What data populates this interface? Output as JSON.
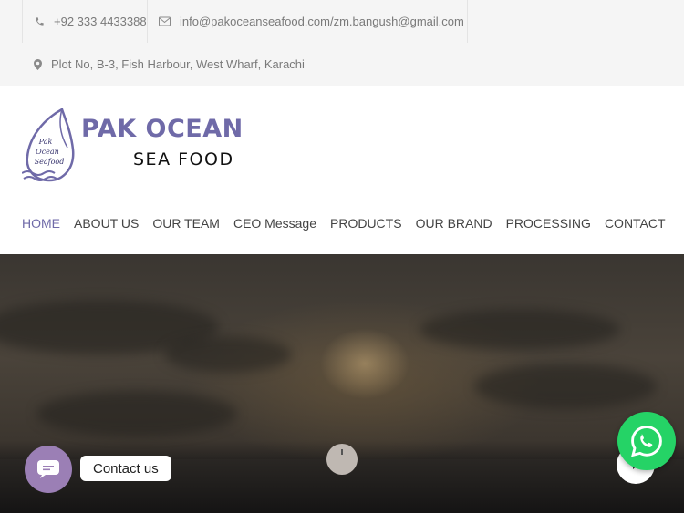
{
  "topbar": {
    "phone": "+92 333 4433388",
    "email": "info@pakoceanseafood.com/zm.bangush@gmail.com",
    "address": "Plot No, B-3, Fish Harbour, West Wharf, Karachi"
  },
  "logo": {
    "brand": "PAK OCEAN",
    "sub": "SEA FOOD",
    "fish_text_1": "Pak",
    "fish_text_2": "Ocean",
    "fish_text_3": "Seafood"
  },
  "nav": {
    "items": [
      "HOME",
      "ABOUT US",
      "OUR TEAM",
      "CEO Message",
      "PRODUCTS",
      "OUR BRAND",
      "PROCESSING",
      "CONTACT"
    ],
    "active": "HOME"
  },
  "widgets": {
    "contact_label": "Contact us"
  },
  "icons": {
    "phone": "phone-icon",
    "email": "envelope-icon",
    "address": "map-pin-icon",
    "whatsapp": "whatsapp-icon",
    "chat": "chat-icon",
    "next": "chevron-right-icon"
  },
  "colors": {
    "accent": "#6f6aa8",
    "topbar_bg": "#f5f5f5",
    "whatsapp": "#25d366",
    "chat": "#9b7fb5"
  }
}
